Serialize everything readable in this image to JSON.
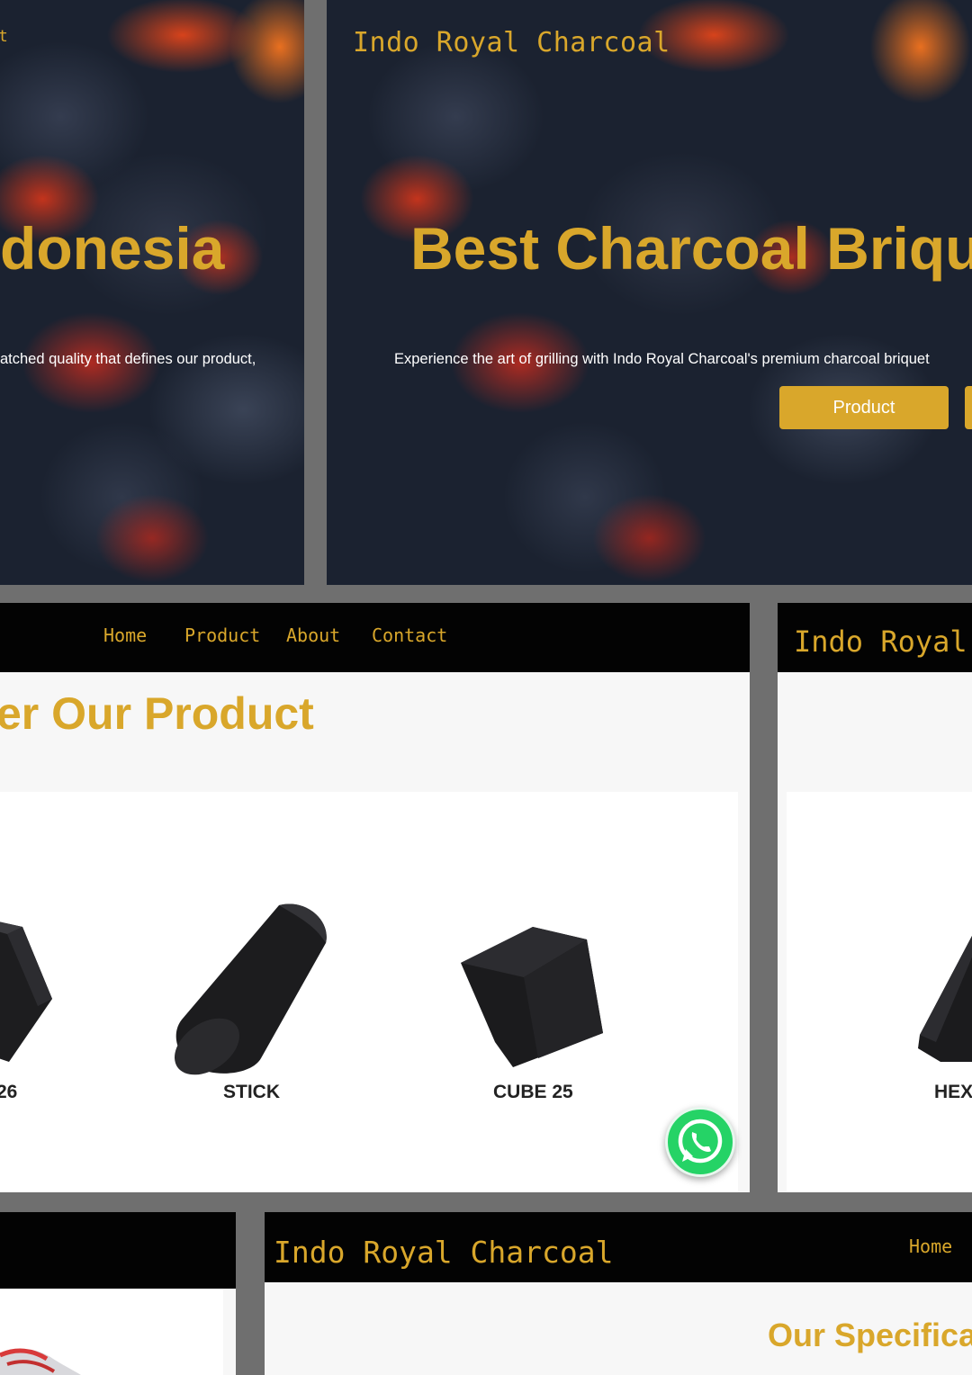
{
  "panel1": {
    "title_fragment": "donesia",
    "subtitle_fragment": "atched quality that defines our product,",
    "corner_fragment": "t"
  },
  "panel2": {
    "brand": "Indo Royal Charcoal",
    "hero_title": "Best Charcoal Briqu",
    "hero_subtitle": "Experience the art of grilling with Indo Royal Charcoal's premium charcoal briquet",
    "product_button": "Product"
  },
  "panel3": {
    "nav": [
      "Home",
      "Product",
      "About",
      "Contact"
    ],
    "section_title": "er Our Product",
    "products": [
      {
        "label": "26",
        "icon": "cube-briquette"
      },
      {
        "label": "STICK",
        "icon": "stick-briquette"
      },
      {
        "label": "CUBE 25",
        "icon": "cube-briquette"
      }
    ],
    "whatsapp_icon": "whatsapp-icon"
  },
  "panel4": {
    "brand": "Indo Royal C",
    "product_label": "HEX"
  },
  "panel6": {
    "brand": "Indo Royal Charcoal",
    "nav_home": "Home",
    "section_title": "Our Specificat"
  },
  "colors": {
    "accent_gold": "#d9a72b",
    "navbar_black": "#030303",
    "whatsapp_green": "#25d366",
    "frame_gray": "#6f6f6f"
  }
}
